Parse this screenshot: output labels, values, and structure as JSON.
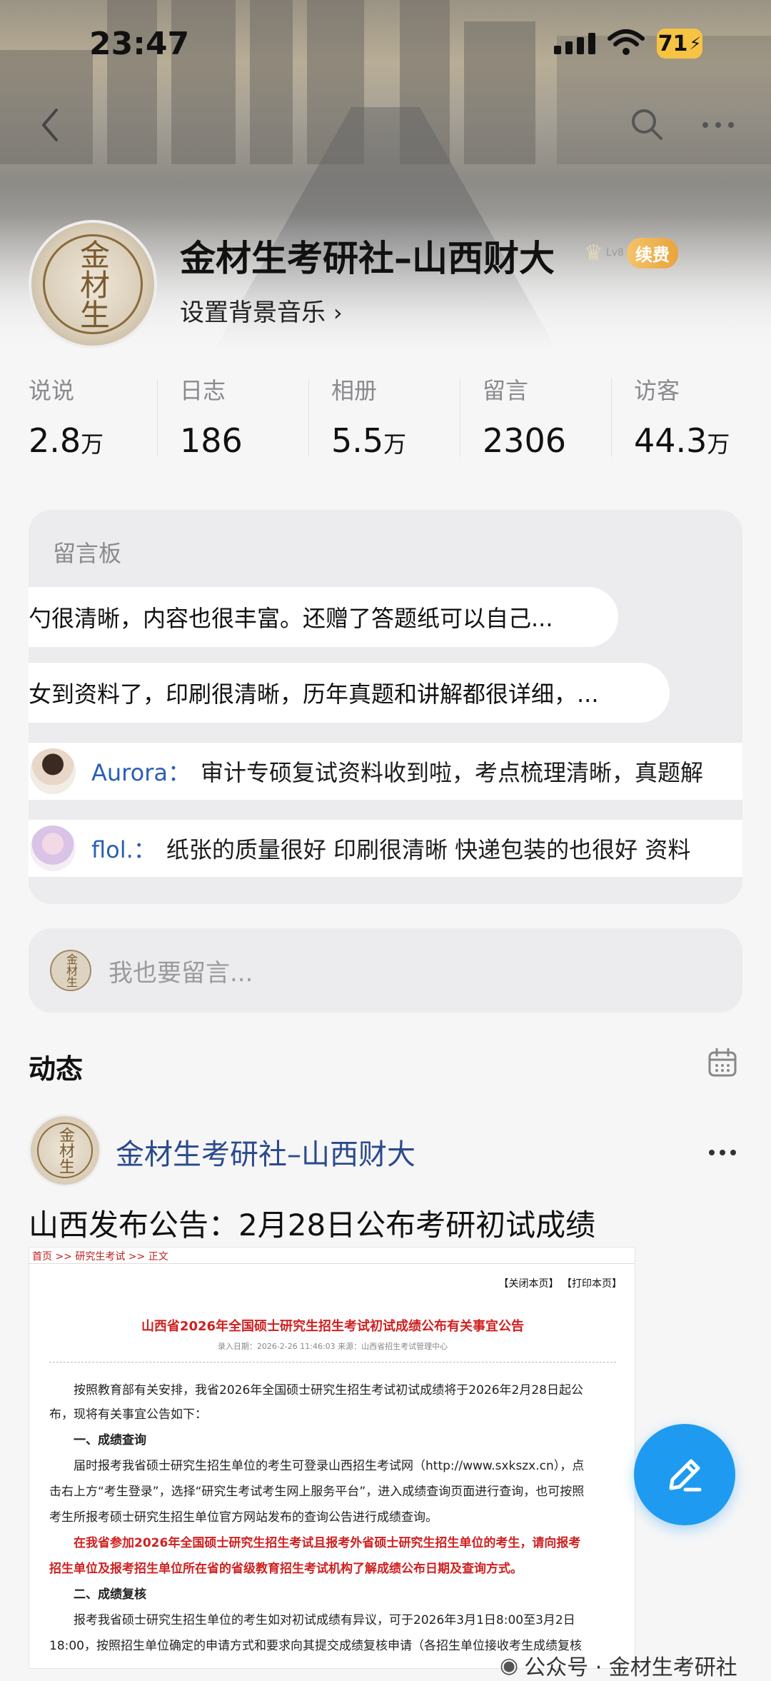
{
  "status_bar": {
    "time": "23:47",
    "battery": "71"
  },
  "nav": {
    "back_icon": "chevron-left-icon",
    "search_icon": "search-icon",
    "more_icon": "more-icon"
  },
  "profile": {
    "name": "金材生考研社–山西财大",
    "seal_text": "金材生",
    "bgm_link": "设置背景音乐",
    "badge_level": "Lv8",
    "renew_label": "续费"
  },
  "stats": [
    {
      "label": "说说",
      "value": "2.8",
      "unit": "万"
    },
    {
      "label": "日志",
      "value": "186",
      "unit": ""
    },
    {
      "label": "相册",
      "value": "5.5",
      "unit": "万"
    },
    {
      "label": "留言",
      "value": "2306",
      "unit": ""
    },
    {
      "label": "访客",
      "value": "44.3",
      "unit": "万"
    }
  ],
  "board": {
    "title": "留言板",
    "pills": [
      "勺很清晰，内容也很丰富。还赠了答题纸可以自己...",
      "女到资料了，印刷很清晰，历年真题和讲解都很详细，..."
    ],
    "messages": [
      {
        "name": "Aurora：",
        "text": "审计专硕复试资料收到啦，考点梳理清晰，真题解"
      },
      {
        "name": "flol.：",
        "text": "纸张的质量很好 印刷很清晰 快递包装的也很好 资料"
      }
    ]
  },
  "compose": {
    "placeholder": "我也要留言..."
  },
  "feed": {
    "title": "动态",
    "calendar_icon": "calendar-icon",
    "post": {
      "author": "金材生考研社–山西财大",
      "title": "山西发布公告：2月28日公布考研初试成绩",
      "notice": {
        "crumb": "首页 >> 研究生考试 >> 正文",
        "tools": "【关闭本页】  【打印本页】",
        "heading": "山西省2026年全国硕士研究生招生考试初试成绩公布有关事宜公告",
        "meta": "录入日期：2026-2-26 11:46:03    来源：山西省招生考试管理中心",
        "lines": [
          "按照教育部有关安排，我省2026年全国硕士研究生招生考试初试成绩将于2026年2月28日起公",
          "布，现将有关事宜公告如下：",
          "一、成绩查询",
          "届时报考我省硕士研究生招生单位的考生可登录山西招生考试网（http://www.sxkszx.cn），点",
          "击右上方“考生登录”，选择“研究生考试考生网上服务平台”，进入成绩查询页面进行查询，也可按照",
          "考生所报考硕士研究生招生单位官方网站发布的查询公告进行成绩查询。",
          "在我省参加2026年全国硕士研究生招生考试且报考外省硕士研究生招生单位的考生，请向报考",
          "招生单位及报考招生单位所在省的省级教育招生考试机构了解成绩公布日期及查询方式。",
          "二、成绩复核",
          "报考我省硕士研究生招生单位的考生如对初试成绩有异议，可于2026年3月1日8:00至3月2日",
          "18:00，按照招生单位确定的申请方式和要求向其提交成绩复核申请（各招生单位接收考生成绩复核"
        ]
      }
    }
  },
  "fab": {
    "icon": "edit-icon"
  },
  "watermark": "公众号 · 金材生考研社",
  "colors": {
    "accent": "#1e9bf0",
    "name_link": "#2b4a8c",
    "notice_red": "#d02020"
  }
}
